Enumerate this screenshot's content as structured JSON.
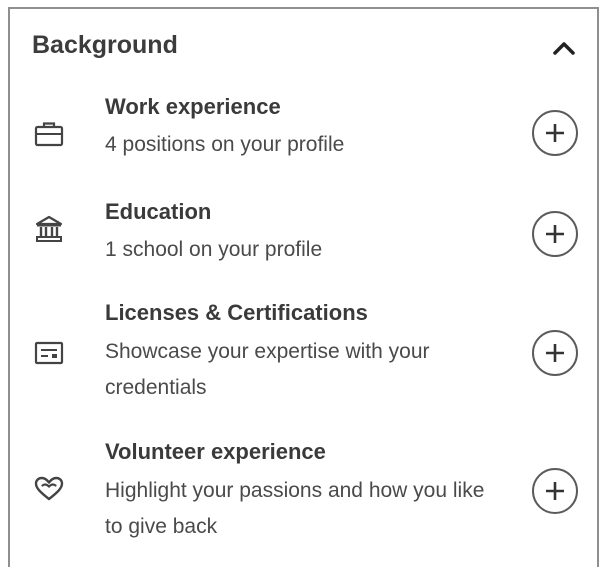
{
  "section": {
    "title": "Background",
    "items": [
      {
        "name": "Work experience",
        "description": "4 positions on your profile",
        "icon": "briefcase-icon"
      },
      {
        "name": "Education",
        "description": "1 school on your profile",
        "icon": "school-icon"
      },
      {
        "name": "Licenses & Certifications",
        "description": "Showcase your expertise with your credentials",
        "icon": "certificate-icon"
      },
      {
        "name": "Volunteer experience",
        "description": "Highlight your passions and how you like to give back",
        "icon": "heart-icon"
      }
    ]
  },
  "colors": {
    "border": "#8f8f8f",
    "icon": "#444444",
    "text": "#3a3a3a"
  }
}
